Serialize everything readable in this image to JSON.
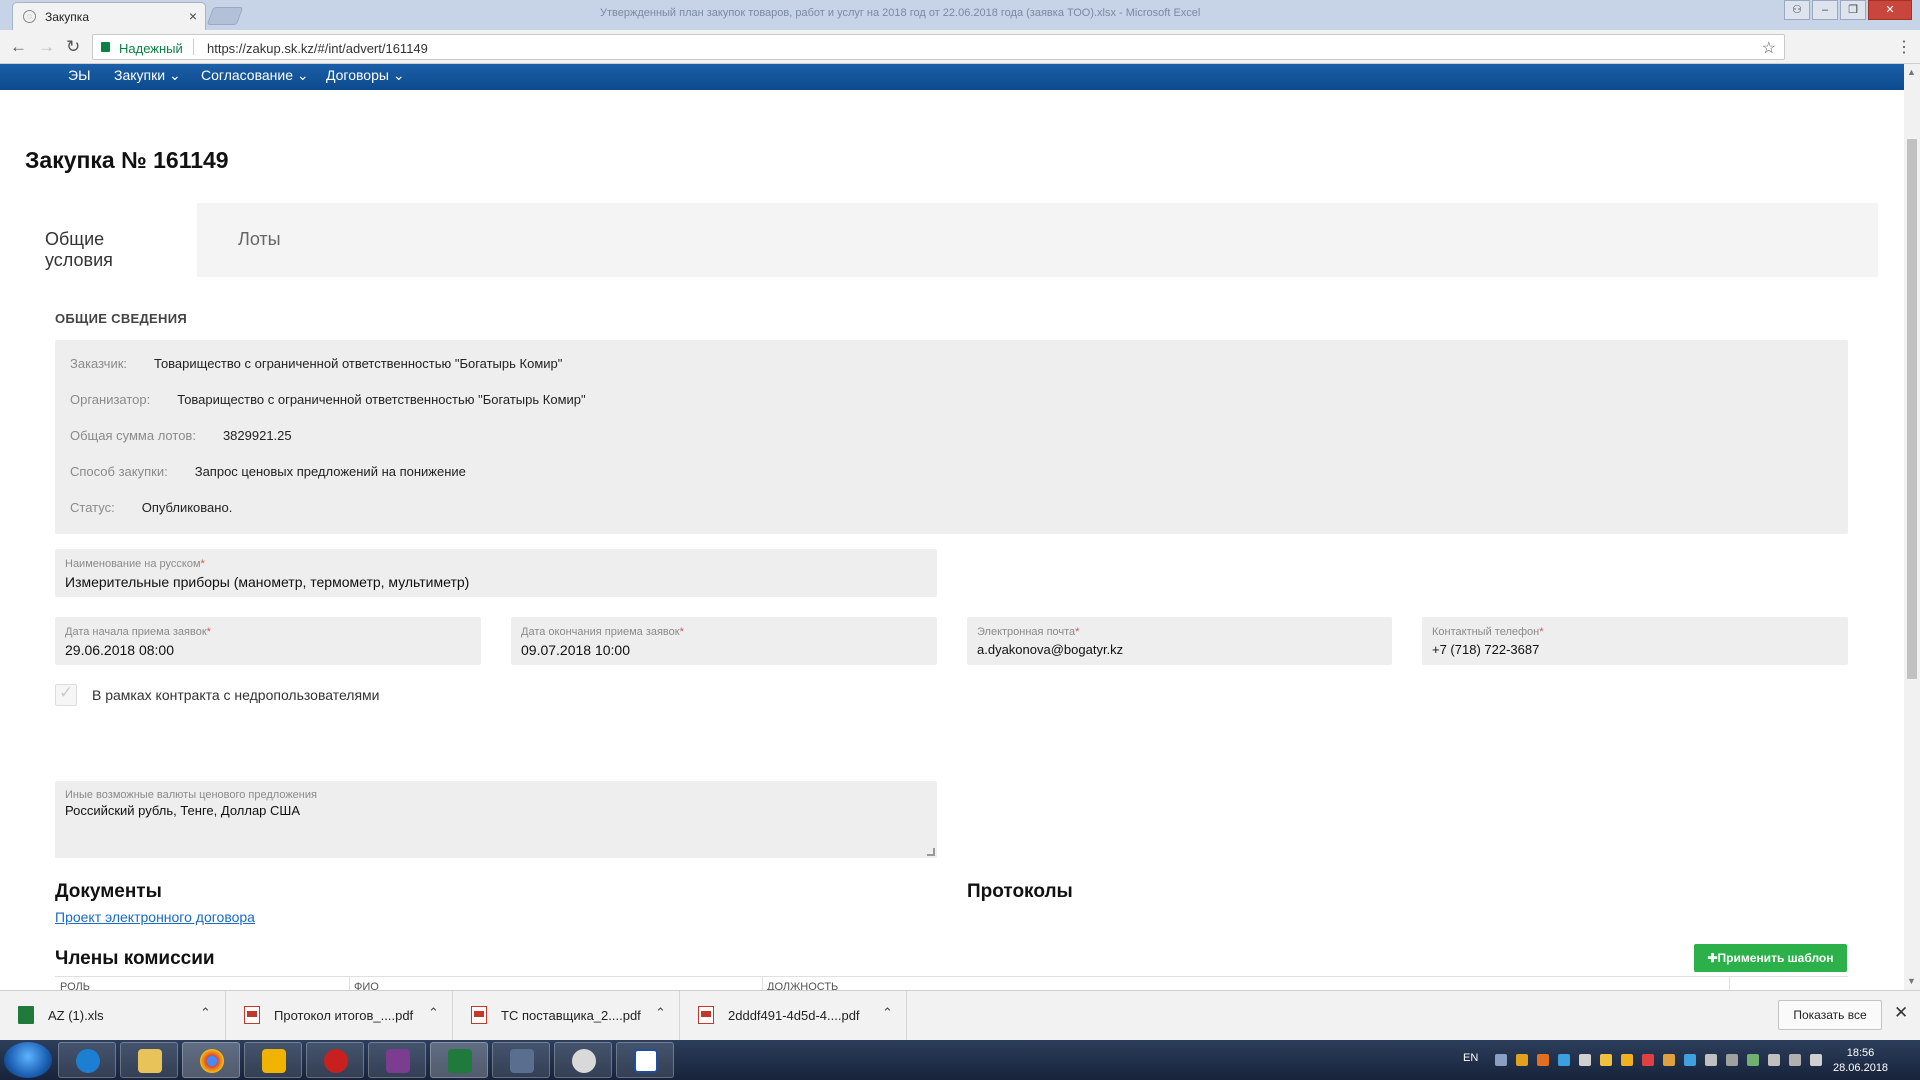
{
  "browser": {
    "window_title": "Утвержденный план закупок товаров, работ и услуг на 2018 год от 22.06.2018 года (заявка ТОО).xlsx - Microsoft Excel",
    "tab_title": "Закупка",
    "security_label": "Надежный",
    "url": "https://zakup.sk.kz/#/int/advert/161149"
  },
  "site_nav": {
    "items": [
      "ЭЫ",
      "Закупки",
      "Согласование",
      "Договоры"
    ]
  },
  "page": {
    "title": "Закупка № 161149",
    "tabs": [
      "Общие условия",
      "Лоты"
    ],
    "section_title": "ОБЩИЕ СВЕДЕНИЯ",
    "info": [
      {
        "label": "Заказчик:",
        "value": "Товарищество с ограниченной ответственностью \"Богатырь Комир\""
      },
      {
        "label": "Организатор:",
        "value": "Товарищество с ограниченной ответственностью \"Богатырь Комир\""
      },
      {
        "label": "Общая сумма лотов:",
        "value": "3829921.25"
      },
      {
        "label": "Способ закупки:",
        "value": "Запрос ценовых предложений на понижение"
      },
      {
        "label": "Статус:",
        "value": "Опубликовано."
      }
    ],
    "name_field": {
      "label": "Наименование на русском",
      "value": "Измерительные приборы (манометр, термометр, мультиметр)"
    },
    "start_date": {
      "label": "Дата начала приема заявок",
      "value": "29.06.2018 08:00"
    },
    "end_date": {
      "label": "Дата окончания приема заявок",
      "value": "09.07.2018 10:00"
    },
    "email": {
      "label": "Электронная почта",
      "value": "a.dyakonova@bogatyr.kz"
    },
    "phone": {
      "label": "Контактный телефон",
      "value": "+7 (718) 722-3687"
    },
    "required_mark": "*",
    "subsoil_checkbox": {
      "label": "В рамках контракта с недропользователями",
      "checked": true
    },
    "currencies": {
      "label": "Иные возможные валюты ценового предложения",
      "value": "Российский  рубль, Тенге, Доллар США"
    },
    "documents_title": "Документы",
    "documents_link": "Проект электронного договора",
    "protocols_title": "Протоколы",
    "commission_title": "Члены комиссии",
    "apply_template_button": "✚Применить шаблон",
    "table_headers": [
      "РОЛЬ",
      "ФИО",
      "ДОЛЖНОСТЬ"
    ]
  },
  "downloads": {
    "items": [
      {
        "name": "AZ (1).xls",
        "icon": "excel-file-icon"
      },
      {
        "name": "Протокол итогов_....pdf",
        "icon": "pdf-file-icon"
      },
      {
        "name": "ТС поставщика_2....pdf",
        "icon": "pdf-file-icon"
      },
      {
        "name": "2dddf491-4d5d-4....pdf",
        "icon": "pdf-file-icon"
      }
    ],
    "show_all": "Показать все"
  },
  "taskbar": {
    "language": "EN",
    "time": "18:56",
    "date": "28.06.2018"
  },
  "colors": {
    "site_nav": "#0d4a8e",
    "apply_button": "#2cb14a",
    "link": "#1a6ac9",
    "field_bg": "#eeeeee"
  }
}
